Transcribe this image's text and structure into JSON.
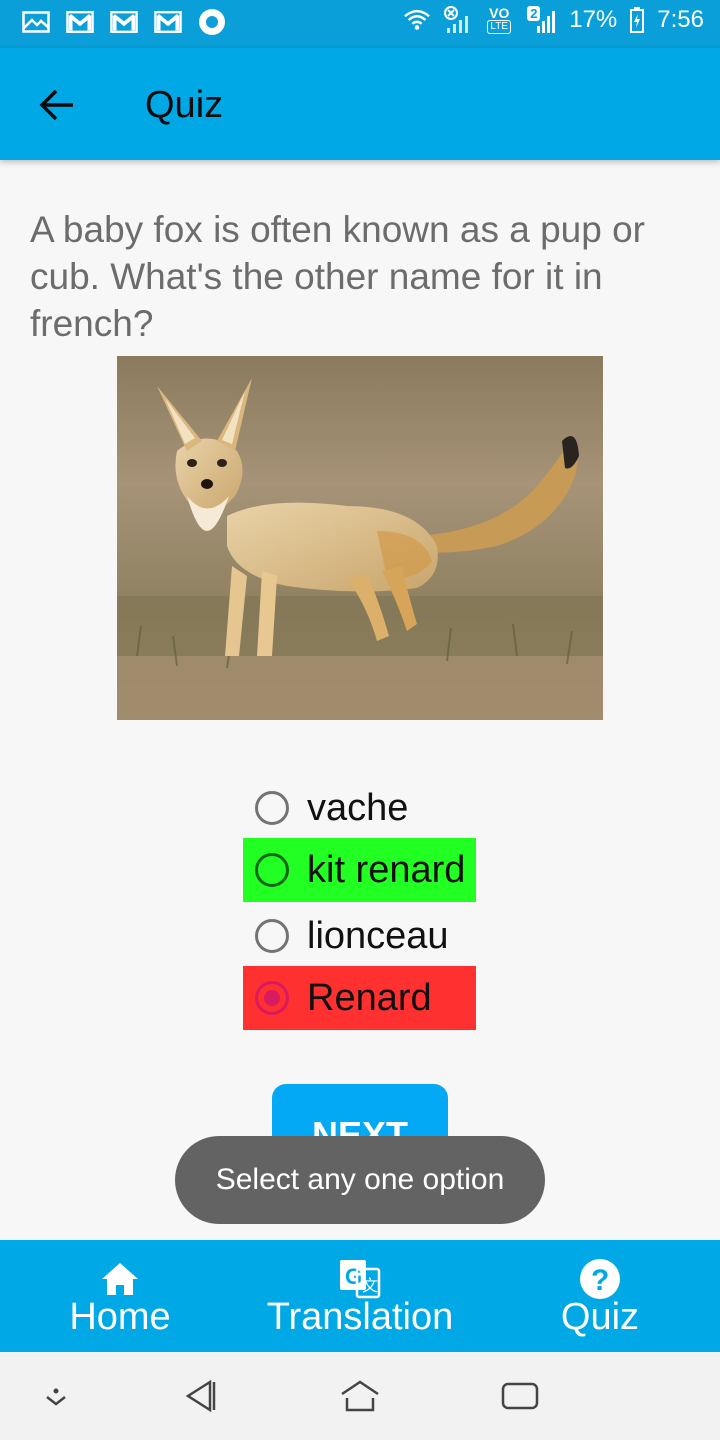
{
  "status_bar": {
    "battery": "17%",
    "time": "7:56",
    "sim_badge": "2",
    "volte": "VO",
    "lte": "LTE",
    "icons": [
      "image-icon",
      "gmail-icon",
      "gmail-icon",
      "gmail-icon",
      "record-icon",
      "wifi-icon",
      "signal-icon",
      "signal-icon",
      "battery-icon"
    ]
  },
  "app_bar": {
    "title": "Quiz",
    "back_icon": "arrow-left-icon"
  },
  "question": {
    "text": "A baby fox is often known as a pup or cub. What's the other name for it in french?"
  },
  "options": [
    {
      "label": "vache",
      "state": "neutral",
      "selected": false
    },
    {
      "label": "kit renard",
      "state": "correct",
      "selected": false
    },
    {
      "label": "lionceau",
      "state": "neutral",
      "selected": false
    },
    {
      "label": "Renard",
      "state": "wrong",
      "selected": true
    }
  ],
  "next_button": {
    "label": "NEXT"
  },
  "toast": {
    "text": "Select any one option"
  },
  "bottom_nav": {
    "items": [
      {
        "label": "Home",
        "icon": "home-icon"
      },
      {
        "label": "Translation",
        "icon": "translate-icon"
      },
      {
        "label": "Quiz",
        "icon": "help-icon"
      }
    ]
  },
  "system_nav": {
    "icons": [
      "collapse-icon",
      "back-triangle-icon",
      "home-outline-icon",
      "recents-icon"
    ]
  },
  "colors": {
    "primary": "#00a8e6",
    "correct": "#22ff22",
    "wrong": "#ff3030",
    "radio_selected": "#d81b60",
    "button": "#03a9f4"
  }
}
